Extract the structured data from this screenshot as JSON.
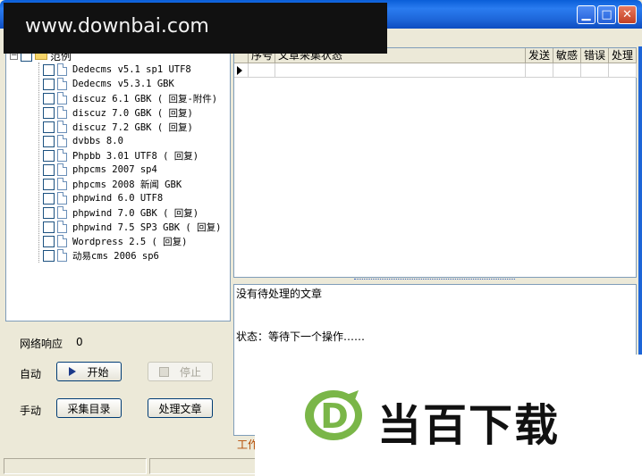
{
  "watermark": {
    "site": "www.downbai.com"
  },
  "tree": {
    "root_label": "范例",
    "items": [
      "Dedecms v5.1 sp1 UTF8",
      "Dedecms v5.3.1 GBK",
      "discuz 6.1 GBK ( 回复-附件)",
      "discuz 7.0 GBK ( 回复)",
      "discuz 7.2 GBK ( 回复)",
      "dvbbs 8.0",
      "Phpbb 3.01 UTF8 ( 回复)",
      "phpcms 2007 sp4",
      "phpcms 2008 新闻 GBK",
      "phpwind 6.0 UTF8",
      "phpwind 7.0 GBK ( 回复)",
      "phpwind 7.5 SP3 GBK ( 回复)",
      "Wordpress 2.5 ( 回复)",
      "动易cms 2006 sp6"
    ]
  },
  "controls": {
    "network_label": "网络响应",
    "network_value": "0",
    "auto_label": "自动",
    "start_button": "开始",
    "stop_button": "停止",
    "manual_label": "手动",
    "collect_button": "采集目录",
    "process_button": "处理文章"
  },
  "grid": {
    "columns": [
      "序号",
      "文章采集状态",
      "发送",
      "敏感",
      "错误",
      "处理"
    ]
  },
  "log": {
    "line1": "没有待处理的文章",
    "line2": "状态：等待下一个操作……"
  },
  "status_tab": "工作",
  "logo": {
    "text": "当百下载",
    "mark_letter": "D"
  },
  "colors": {
    "titlebar": "#1d65d8",
    "logo_green": "#7ab648"
  }
}
